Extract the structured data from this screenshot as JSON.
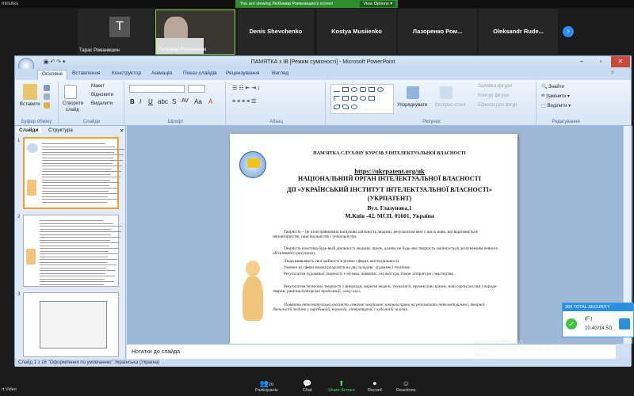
{
  "zoom": {
    "top_left": "minutes",
    "viewing_banner": "You are viewing Любомир Романишин's screen",
    "view_options": "View Options ▾",
    "participants": [
      {
        "initial": "T",
        "name": "Тарас Романишин"
      },
      {
        "name": "Любомир Романишин"
      },
      {
        "name": "Denis Shevchenko"
      },
      {
        "name": "Kostya Musiienko"
      },
      {
        "name": "Лазоренко  Ром..."
      },
      {
        "name": "Oleksandr  Rude..."
      }
    ],
    "toolbar": {
      "left": "rt Video",
      "participants_count": "20",
      "participants": "Participants",
      "chat": "Chat",
      "share": "Share Screen",
      "record": "Record",
      "reactions": "Reactions"
    }
  },
  "ppt": {
    "title": "ПАМЯТКА з ІВ [Режим сумісності] - Microsoft PowerPoint",
    "tabs": [
      "Основне",
      "Вставлення",
      "Конструктор",
      "Анімація",
      "Показ слайдів",
      "Рецензування",
      "Вигляд"
    ],
    "groups": {
      "clipboard": "Буфер обміну",
      "slides": "Слайди",
      "font": "Шрифт",
      "paragraph": "Абзац",
      "drawing": "Рисунок",
      "editing": "Редагування"
    },
    "ribbon": {
      "paste": "Вставити",
      "create": "Створити",
      "slide": "слайд",
      "layout": "Макет",
      "reset": "Відновити",
      "delete": "Видалити",
      "arrange": "Упорядкувати",
      "quick_styles": "Експрес-стилі",
      "fill": "Заливка фігури",
      "outline": "Контур фігури",
      "effects": "Ефекти для фігур",
      "find": "Знайти",
      "replace": "Замінити",
      "select": "Виділити"
    },
    "pane_tabs": [
      "Слайди",
      "Структура"
    ],
    "slide_numbers": [
      "1",
      "2",
      "3"
    ],
    "notes": "Нотатки до слайда",
    "status": "Слайд 1 з 16   \"Оформлення по умовчанню\"   Українська (Україна)",
    "slide": {
      "heading": "ПАМ'ЯТКА СЛУХАЧУ КУРСІВ З ІНТЕЛЕКТУАЛЬНОЇ ВЛАСНОСТІ",
      "url": "https://ukrpatent.org/uk",
      "org1": "НАЦІОНАЛЬНИЙ ОРГАН ІНТЕЛЕКТУАЛЬНОЇ ВЛАСНОСТІ",
      "org2": "ДП «УКРАЇНСЬКИЙ ІНСТИТУТ ІНТЕЛЕКТУАЛЬНОЇ ВЛАСНОСТІ»",
      "org3": "(УКРПАТЕНТ)",
      "addr1": "Вул. Глазунова,1",
      "addr2": "М.Київ -42. МСП.  01601, Україна",
      "p1": "Творчість – це цілеспрямована пошукова діяльність людини, результатом якої є щось нове, що відрізняється неповторністю, оригінальністю і унікальністю.",
      "p2": "Творчість властива будь-якій діяльності людини, проте, далеко не будь-яка творчість закінчується досягненням певного об'єктивного результату.",
      "p3": "Люди виявляють свої здібності в різних сферах життєдіяльності.",
      "p4": "Умовно ці сфери можна розділити на дві складові: художню і технічну.",
      "p5": "Результатом художньої творчості є музика, живопис, скульптура, твори літератури і мистецтва.",
      "p6": "Результатом технічної творчості є винаходи, корисні моделі, технології, промислові зразки, нові сорти рослин і породи тварин, раціоналізаторські пропозиції, «ноу-хау».",
      "p7": "Поняття інтелектуальна власність означає закріплені законом права на результати інтелектуальної, творчої діяльності людини у виробничій, науковій, літературній і художній галузях."
    }
  },
  "security": {
    "title": "360 TOTAL SECURITY",
    "drive": "(F:)",
    "size": "10.4G/14.5G"
  },
  "watermark": {
    "line1": "Активація Windows",
    "line2": "Перейдіть до розділу \"Настройки\", щоб активувати",
    "line3": "Windows."
  }
}
